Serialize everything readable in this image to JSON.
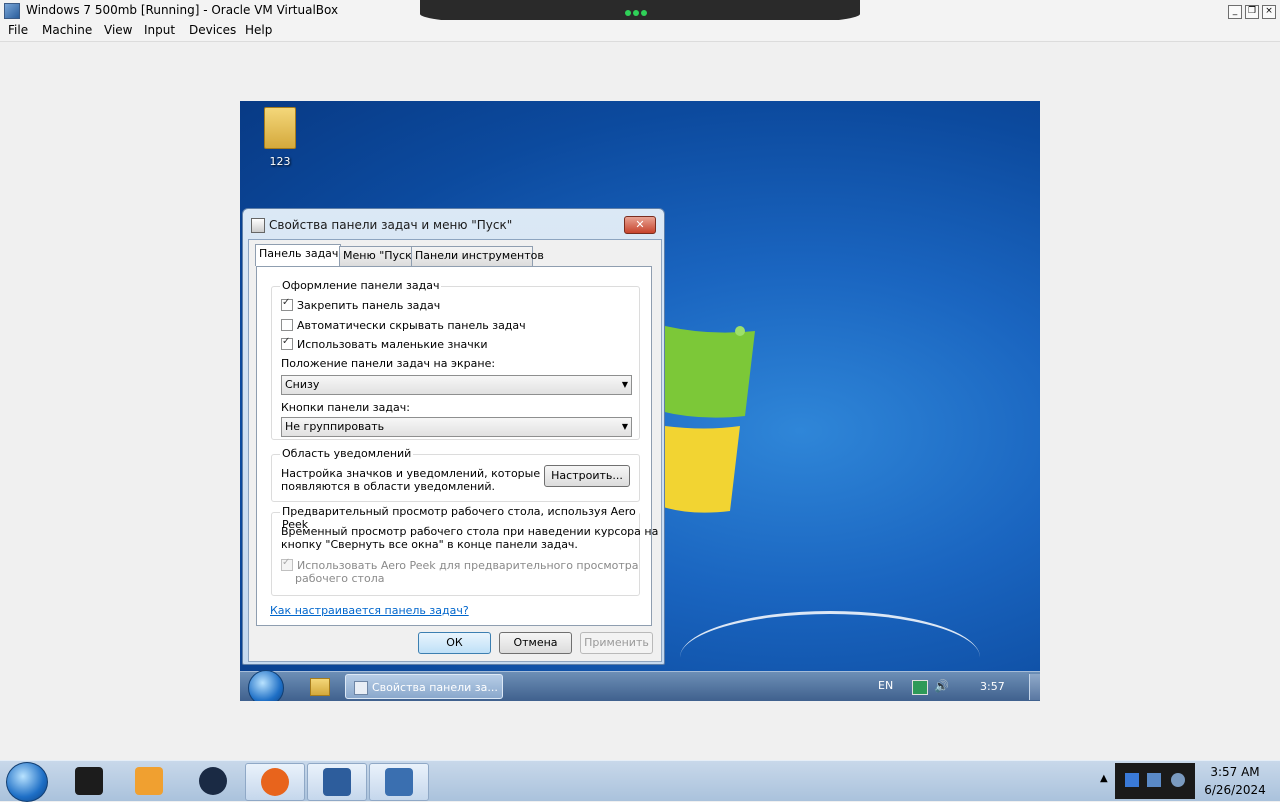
{
  "host": {
    "title": "Windows 7 500mb [Running] - Oracle VM VirtualBox",
    "menu": [
      "File",
      "Machine",
      "View",
      "Input",
      "Devices",
      "Help"
    ],
    "taskbar": {
      "time": "3:57 AM",
      "date": "6/26/2024",
      "apps": [
        {
          "name": "terminal",
          "color": "#1c1c1c"
        },
        {
          "name": "media-player",
          "color": "#f0a030"
        },
        {
          "name": "app-dark-globe",
          "color": "#1a2a44"
        },
        {
          "name": "firefox",
          "color": "#e8641c"
        },
        {
          "name": "virtualbox",
          "color": "#2d5d9c"
        },
        {
          "name": "windows7-64",
          "color": "#3a6fb0"
        }
      ]
    }
  },
  "vm": {
    "desktop_icon_label": "123",
    "dialog": {
      "title": "Свойства панели задач и меню \"Пуск\"",
      "tabs": [
        "Панель задач",
        "Меню \"Пуск\"",
        "Панели инструментов"
      ],
      "group1": {
        "title": "Оформление панели задач",
        "lock": "Закрепить панель задач",
        "autohide": "Автоматически скрывать панель задач",
        "small_icons": "Использовать маленькие значки",
        "position_label": "Положение панели задач на экране:",
        "position_value": "Снизу",
        "buttons_label": "Кнопки панели задач:",
        "buttons_value": "Не группировать"
      },
      "group2": {
        "title": "Область уведомлений",
        "text1": "Настройка значков и уведомлений, которые",
        "text2": "появляются в области уведомлений.",
        "button": "Настроить..."
      },
      "group3": {
        "title": "Предварительный просмотр рабочего стола, используя Aero Peek",
        "text1": "Временный просмотр рабочего стола при наведении курсора на",
        "text2": "кнопку \"Свернуть все окна\" в конце панели задач.",
        "check1": "Использовать Aero Peek для предварительного просмотра",
        "check2": "рабочего стола"
      },
      "help_link": "Как настраивается панель задач?",
      "ok": "ОК",
      "cancel": "Отмена",
      "apply": "Применить"
    },
    "taskbar": {
      "task_label": "Свойства панели за...",
      "lang": "EN",
      "clock": "3:57"
    }
  }
}
